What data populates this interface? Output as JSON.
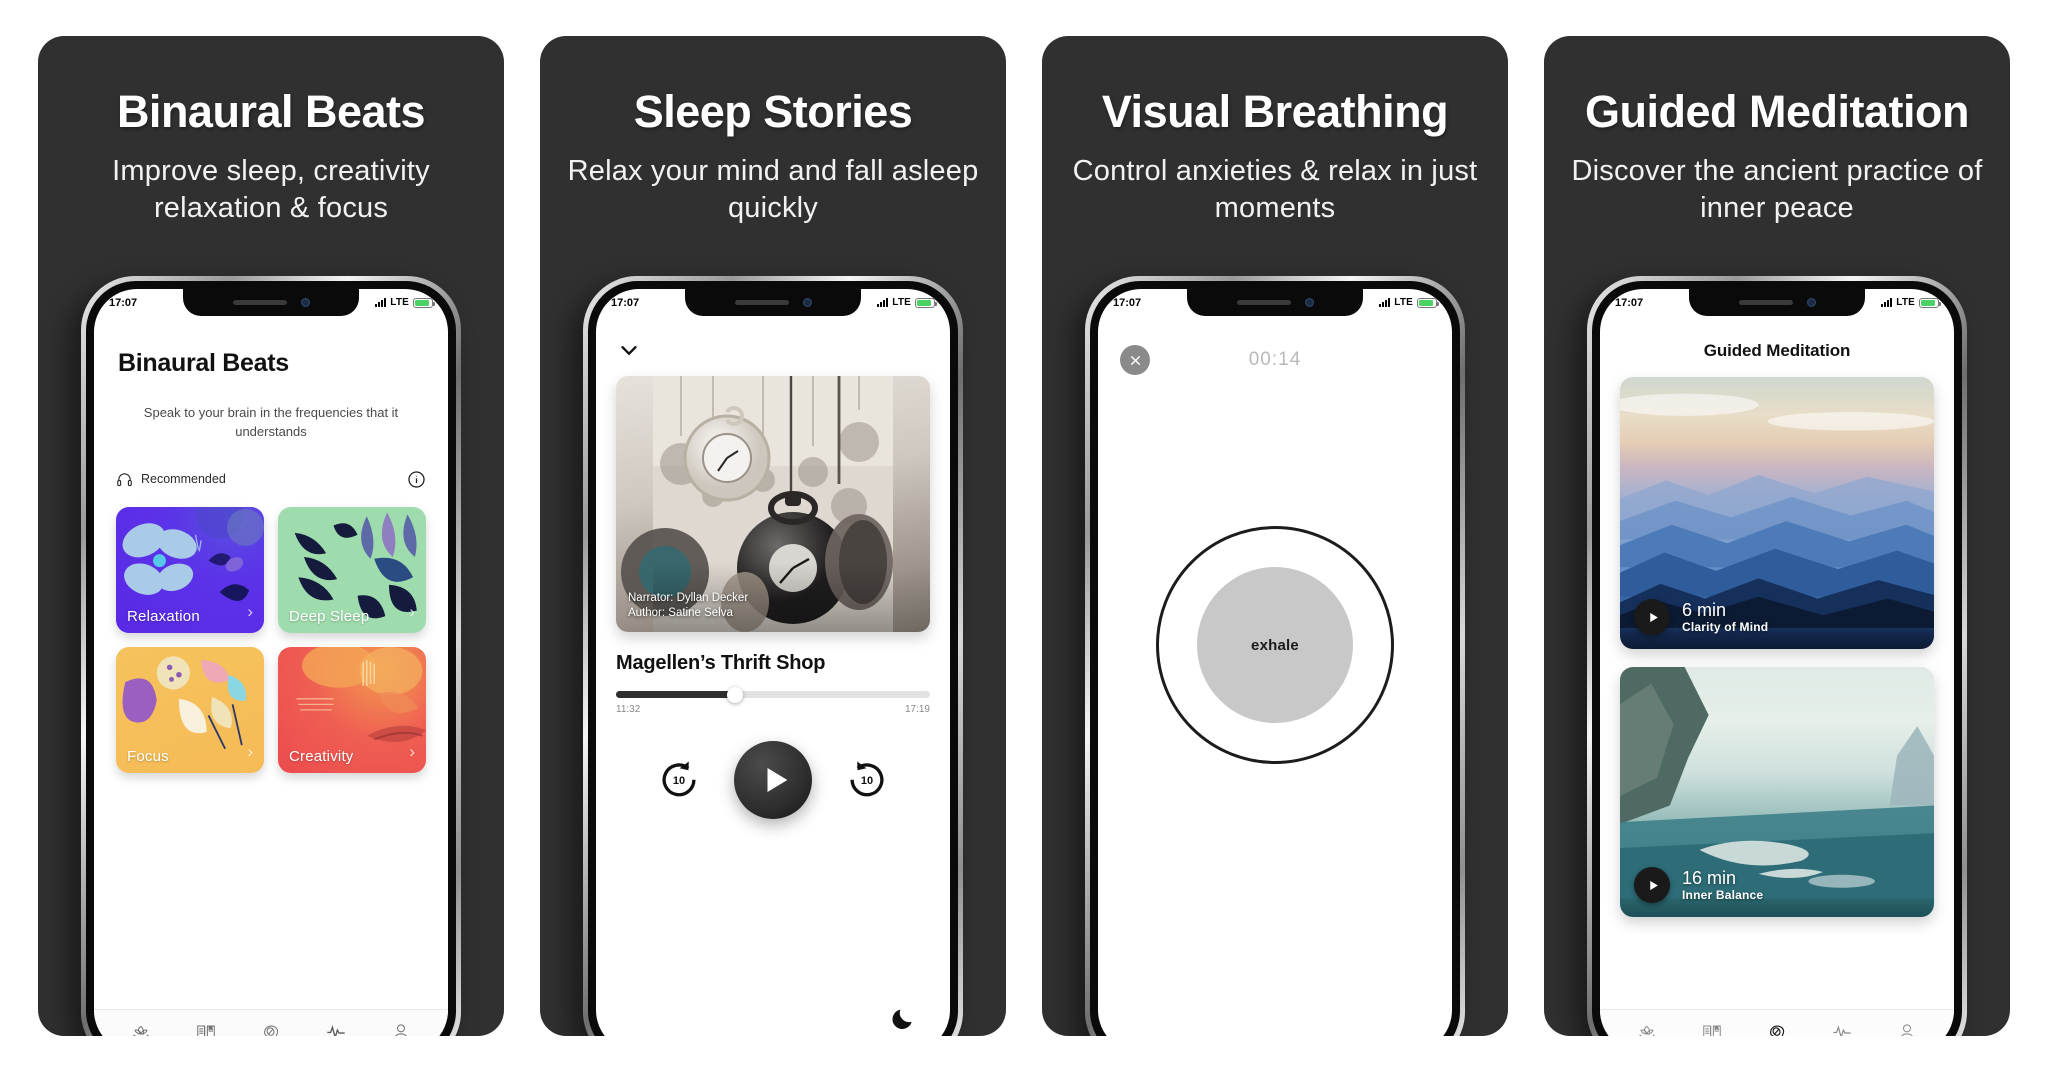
{
  "panels": [
    {
      "title": "Binaural Beats",
      "subtitle": "Improve sleep, creativity relaxation & focus",
      "status": {
        "time": "17:07",
        "network": "LTE"
      },
      "screen": {
        "heading": "Binaural Beats",
        "tagline": "Speak to your brain in the frequencies that it understands",
        "section_label": "Recommended",
        "cards": [
          {
            "label": "Relaxation"
          },
          {
            "label": "Deep Sleep"
          },
          {
            "label": "Focus"
          },
          {
            "label": "Creativity"
          }
        ]
      }
    },
    {
      "title": "Sleep Stories",
      "subtitle": "Relax your mind and fall asleep quickly",
      "status": {
        "time": "17:07",
        "network": "LTE"
      },
      "screen": {
        "narrator": "Narrator: Dyllan Decker",
        "author": "Author: Satine Selva",
        "story_title": "Magellen’s Thrift Shop",
        "elapsed": "11:32",
        "duration": "17:19",
        "progress_percent": 38,
        "skip_back_label": "10",
        "skip_forward_label": "10"
      }
    },
    {
      "title": "Visual Breathing",
      "subtitle": "Control anxieties & relax in just moments",
      "status": {
        "time": "17:07",
        "network": "LTE"
      },
      "screen": {
        "timer": "00:14",
        "breath_state": "exhale"
      }
    },
    {
      "title": "Guided Meditation",
      "subtitle": "Discover the ancient practice of inner peace",
      "status": {
        "time": "17:07",
        "network": "LTE"
      },
      "screen": {
        "heading": "Guided Meditation",
        "sessions": [
          {
            "duration": "6 min",
            "name": "Clarity of Mind"
          },
          {
            "duration": "16 min",
            "name": "Inner Balance"
          }
        ]
      }
    }
  ],
  "tabbar": {
    "items": [
      {
        "icon": "lotus-icon"
      },
      {
        "icon": "book-icon"
      },
      {
        "icon": "mind-leaf-icon"
      },
      {
        "icon": "pulse-icon"
      },
      {
        "icon": "person-icon"
      }
    ]
  },
  "colors": {
    "panel_bg": "#303030",
    "relaxation": "#5a28e6",
    "deep_sleep": "#9fdcad",
    "focus": "#f5bb57",
    "creativity": "#ec4a4e",
    "battery": "#4cd164"
  }
}
